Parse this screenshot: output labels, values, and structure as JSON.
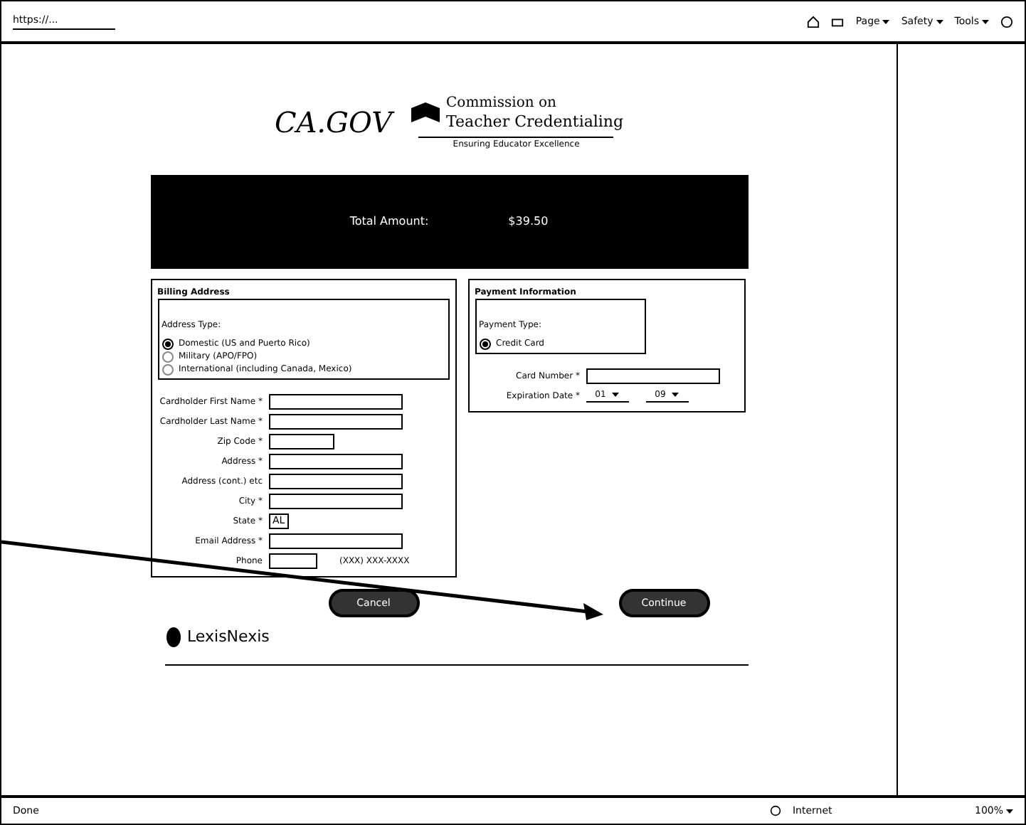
{
  "browser": {
    "tab_title": "https://...",
    "toolbar": [
      "Page",
      "Safety",
      "Tools"
    ]
  },
  "header": {
    "logo": "CA.GOV",
    "agency_line_1": "Commission on",
    "agency_line_2": "Teacher Credentialing",
    "tagline": "Ensuring Educator Excellence"
  },
  "banner": {
    "label": "Total Amount:",
    "amount": "$39.50"
  },
  "billing": {
    "title": "Billing Address",
    "address_type": {
      "legend": "Address Type:",
      "options": [
        {
          "label": "Domestic (US and Puerto Rico)",
          "selected": true
        },
        {
          "label": "Military (APO/FPO)",
          "selected": false
        },
        {
          "label": "International (including Canada, Mexico)",
          "selected": false
        }
      ]
    },
    "fields": [
      {
        "label": "Cardholder First Name *",
        "kind": "text"
      },
      {
        "label": "Cardholder Last Name *",
        "kind": "text"
      },
      {
        "label": "Zip Code *",
        "kind": "short"
      },
      {
        "label": "Address *",
        "kind": "text"
      },
      {
        "label": "Address (cont.) etc",
        "kind": "text"
      },
      {
        "label": "City *",
        "kind": "text"
      },
      {
        "label": "State *",
        "kind": "select",
        "value": "AL"
      },
      {
        "label": "Email Address *",
        "kind": "text"
      },
      {
        "label": "Phone",
        "kind": "phone",
        "hint": "(XXX) XXX-XXXX"
      }
    ]
  },
  "payment": {
    "title": "Payment Information",
    "payment_type": {
      "legend": "Payment Type:",
      "options": [
        {
          "label": "Credit Card",
          "selected": true
        }
      ]
    },
    "fields": [
      {
        "label": "Card Number *",
        "kind": "text"
      },
      {
        "label": "Expiration Date *",
        "kind": "expiry",
        "values": [
          "01",
          "09"
        ]
      }
    ]
  },
  "buttons": [
    "Cancel",
    "Continue"
  ],
  "footer_logo": "LexisNexis",
  "status_bar": {
    "status": "Done",
    "zone": "Internet",
    "zoom": "100%"
  }
}
